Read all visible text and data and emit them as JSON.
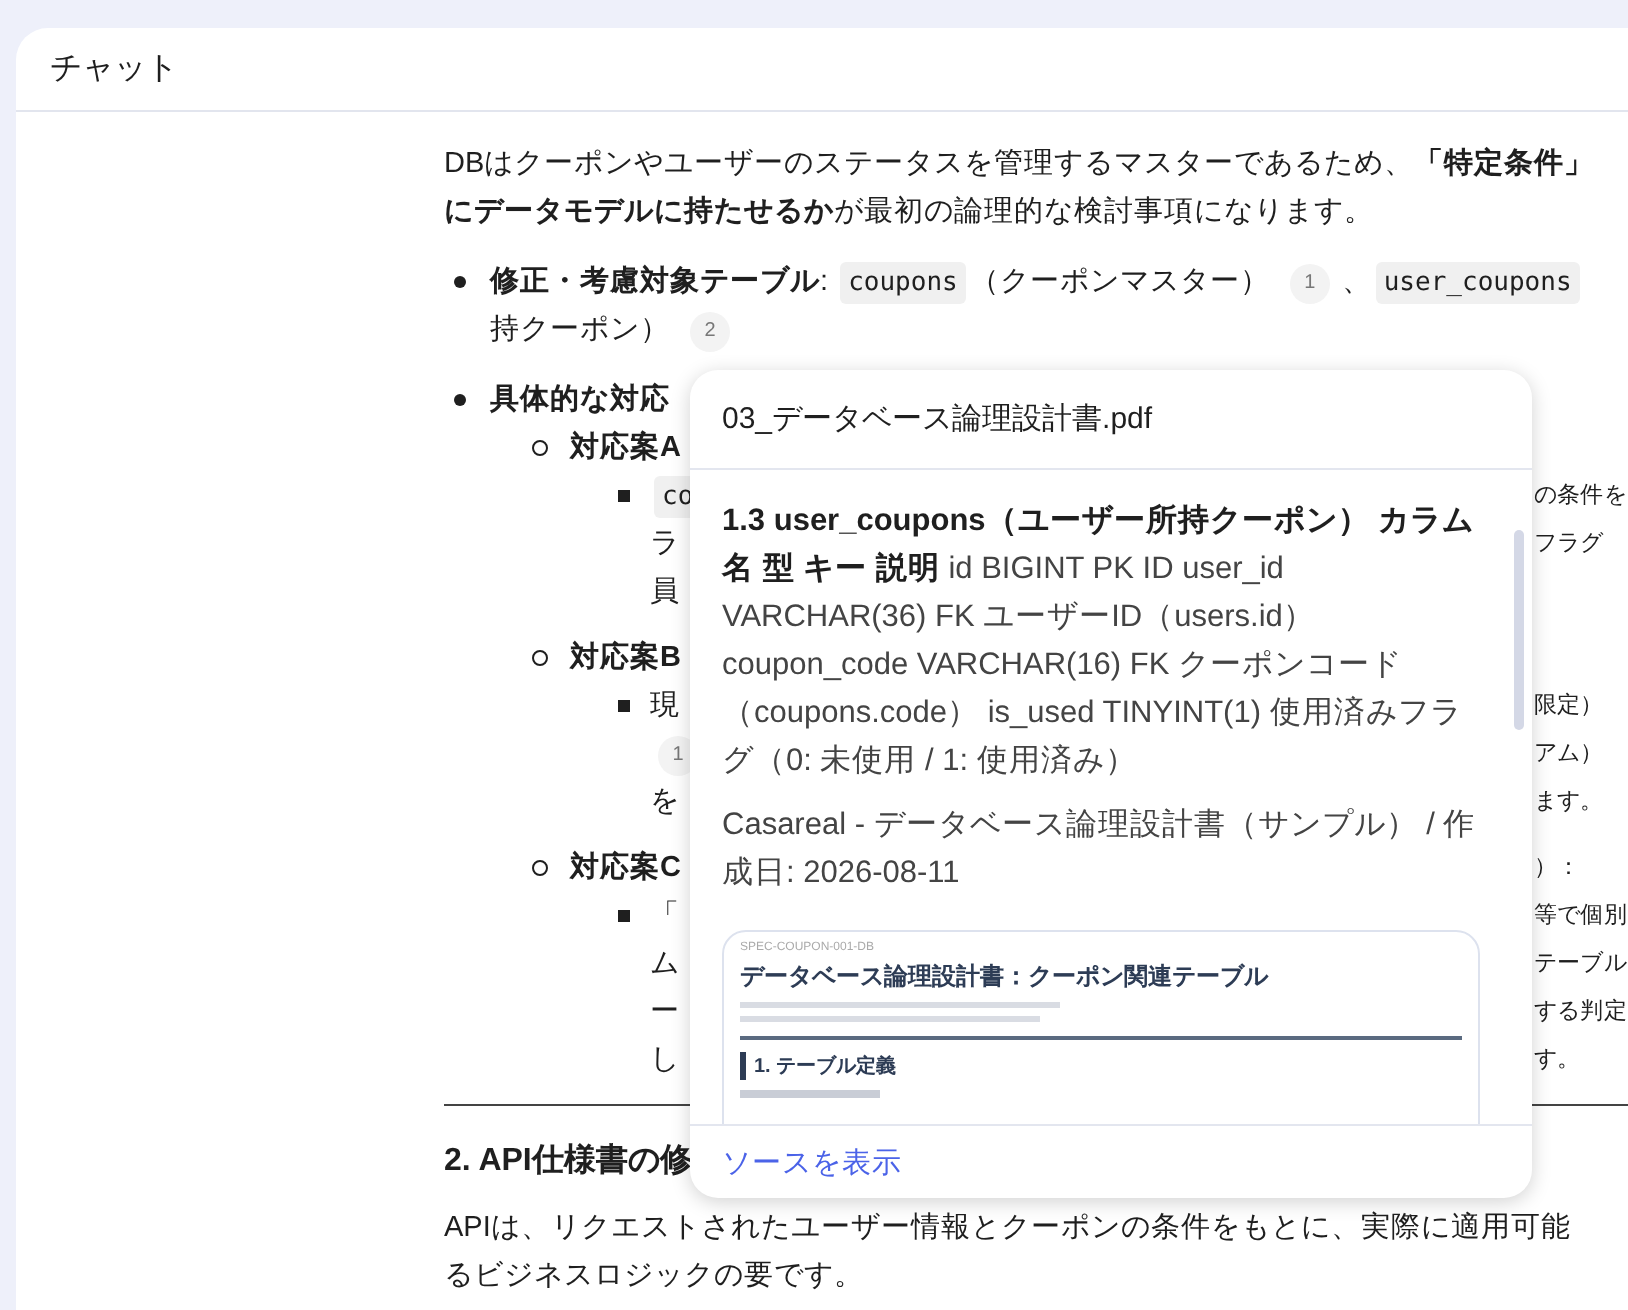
{
  "header": {
    "title": "チャット"
  },
  "lines": [
    {
      "kind": "para",
      "parts": [
        {
          "kind": "text",
          "text": "DBはクーポンやユーザーのステータスを管理するマスターであるため、"
        },
        {
          "kind": "bold",
          "text": "「特定条件」"
        }
      ]
    },
    {
      "kind": "para-cont",
      "parts": [
        {
          "kind": "bold",
          "text": "にデータモデルに持たせるか"
        },
        {
          "kind": "text",
          "text": "が最初の論理的な検討事項になります。"
        }
      ]
    },
    {
      "kind": "item",
      "parts": [
        {
          "kind": "bold",
          "text": "修正・考慮対象テーブル"
        },
        {
          "kind": "text",
          "text": ": "
        },
        {
          "kind": "code",
          "text": "coupons"
        },
        {
          "kind": "text",
          "text": "（クーポンマスター）"
        },
        {
          "kind": "cite",
          "text": "1"
        },
        {
          "kind": "text",
          "text": "、"
        },
        {
          "kind": "code",
          "text": "user_coupons"
        }
      ]
    },
    {
      "kind": "item-cont",
      "parts": [
        {
          "kind": "text",
          "text": "持クーポン）"
        },
        {
          "kind": "cite",
          "text": "2"
        }
      ]
    },
    {
      "kind": "item",
      "parts": [
        {
          "kind": "bold",
          "text": "具体的な対応"
        }
      ]
    },
    {
      "kind": "option",
      "parts": [
        {
          "kind": "bold",
          "text": "対応案A"
        }
      ]
    },
    {
      "kind": "detail",
      "parts": [
        {
          "kind": "code",
          "text": "co"
        }
      ],
      "right": "の条件を"
    },
    {
      "kind": "detail-cont",
      "parts": [
        {
          "kind": "text",
          "text": "ラ"
        }
      ],
      "right": "フラグ"
    },
    {
      "kind": "detail-cont",
      "parts": [
        {
          "kind": "text",
          "text": "員"
        }
      ]
    },
    {
      "kind": "option",
      "parts": [
        {
          "kind": "bold",
          "text": "対応案B"
        }
      ]
    },
    {
      "kind": "detail",
      "parts": [
        {
          "kind": "text",
          "text": "現"
        }
      ],
      "right": "限定）"
    },
    {
      "kind": "detail-cont",
      "parts": [
        {
          "kind": "cite",
          "text": "1"
        }
      ],
      "right": "アム）"
    },
    {
      "kind": "detail-cont",
      "parts": [
        {
          "kind": "text",
          "text": "を"
        }
      ],
      "right": "ます。"
    },
    {
      "kind": "option",
      "parts": [
        {
          "kind": "bold",
          "text": "対応案C"
        }
      ],
      "right": "）："
    },
    {
      "kind": "detail",
      "parts": [
        {
          "kind": "text",
          "text": "「"
        }
      ],
      "right": "等で個別"
    },
    {
      "kind": "detail-cont",
      "parts": [
        {
          "kind": "text",
          "text": "ム"
        }
      ],
      "right": "テーブル"
    },
    {
      "kind": "detail-cont",
      "parts": [
        {
          "kind": "text",
          "text": "ー"
        }
      ],
      "right": "する判定"
    },
    {
      "kind": "detail-cont",
      "parts": [
        {
          "kind": "text",
          "text": "し"
        }
      ],
      "right": "す。"
    },
    {
      "kind": "rule"
    },
    {
      "kind": "heading",
      "parts": [
        {
          "kind": "bold",
          "text": "2. API仕様書の修"
        }
      ]
    },
    {
      "kind": "para",
      "parts": [
        {
          "kind": "text",
          "text": "APIは、リクエストされたユーザー情報とクーポンの条件をもとに、実際に適用可能"
        }
      ]
    },
    {
      "kind": "para-cont",
      "parts": [
        {
          "kind": "text",
          "text": "るビジネスロジックの要です。"
        }
      ]
    }
  ],
  "popup": {
    "filename": "03_データベース論理設計書.pdf",
    "excerpt": "**1.3 user_coupons（ユーザー所持クーポン） カラム名 型 キー 説明** id BIGINT PK ID user_id VARCHAR(36) FK ユーザーID（users.id） coupon_code VARCHAR(16) FK クーポンコード（coupons.code） is_used TINYINT(1) 使用済みフラグ（0: 未使用 / 1: 使用済み）",
    "source": "Casareal - データベース論理設計書（サンプル） / 作成日: 2026-08-11",
    "preview": {
      "code": "SPEC-COUPON-001-DB",
      "title": "データベース論理設計書：クーポン関連テーブル",
      "section": "1. テーブル定義"
    },
    "link": "ソースを表示"
  }
}
